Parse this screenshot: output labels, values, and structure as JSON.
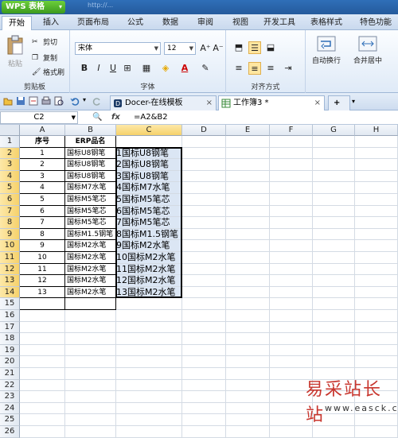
{
  "app": {
    "title": "WPS 表格",
    "url_hint": "http://..."
  },
  "menu": {
    "tabs": [
      "开始",
      "插入",
      "页面布局",
      "公式",
      "数据",
      "审阅",
      "视图",
      "开发工具",
      "表格样式",
      "特色功能"
    ]
  },
  "ribbon": {
    "paste_label": "粘贴",
    "cut_label": "剪切",
    "copy_label": "复制",
    "format_painter_label": "格式刷",
    "clipboard_group": "剪贴板",
    "font_name": "宋体",
    "font_size": "12",
    "font_group": "字体",
    "align_group": "对齐方式",
    "wrap_label": "自动换行",
    "merge_label": "合并居中",
    "bold": "B",
    "italic": "I",
    "underline": "U",
    "grow_font": "A⁺",
    "shrink_font": "A⁻"
  },
  "tabs": {
    "doc1": "Docer-在线模板",
    "doc2": "工作簿3 *",
    "add": "+"
  },
  "formula_bar": {
    "name_box": "C2",
    "fx": "fx",
    "formula": "=A2&B2"
  },
  "sheet": {
    "columns": [
      "A",
      "B",
      "C",
      "D",
      "E",
      "F",
      "G",
      "H"
    ],
    "rows": [
      "1",
      "2",
      "3",
      "4",
      "5",
      "6",
      "7",
      "8",
      "9",
      "10",
      "11",
      "12",
      "13",
      "14",
      "15",
      "16",
      "17",
      "18",
      "19",
      "20",
      "21",
      "22",
      "23",
      "24",
      "25",
      "26"
    ],
    "headers": {
      "a": "序号",
      "b": "ERP品名"
    },
    "data": [
      {
        "a": "1",
        "b": "国标U8钢笔",
        "c": "1国标U8钢笔"
      },
      {
        "a": "2",
        "b": "国标U8钢笔",
        "c": "2国标U8钢笔"
      },
      {
        "a": "3",
        "b": "国标U8钢笔",
        "c": "3国标U8钢笔"
      },
      {
        "a": "4",
        "b": "国标M7水笔",
        "c": "4国标M7水笔"
      },
      {
        "a": "5",
        "b": "国标M5笔芯",
        "c": "5国标M5笔芯"
      },
      {
        "a": "6",
        "b": "国标M5笔芯",
        "c": "6国标M5笔芯"
      },
      {
        "a": "7",
        "b": "国标M5笔芯",
        "c": "7国标M5笔芯"
      },
      {
        "a": "8",
        "b": "国标M1.5钢笔",
        "c": "8国标M1.5钢笔"
      },
      {
        "a": "9",
        "b": "国标M2水笔",
        "c": "9国标M2水笔"
      },
      {
        "a": "10",
        "b": "国标M2水笔",
        "c": "10国标M2水笔"
      },
      {
        "a": "11",
        "b": "国标M2水笔",
        "c": "11国标M2水笔"
      },
      {
        "a": "12",
        "b": "国标M2水笔",
        "c": "12国标M2水笔"
      },
      {
        "a": "13",
        "b": "国标M2水笔",
        "c": "13国标M2水笔"
      }
    ]
  },
  "watermark": {
    "line1": "易采站长站",
    "line2": "www.easck.com"
  },
  "colors": {
    "accent": "#2f6fb8",
    "selection": "#dbe6f4",
    "header_sel": "#f6d26b",
    "watermark": "#c8362e"
  }
}
